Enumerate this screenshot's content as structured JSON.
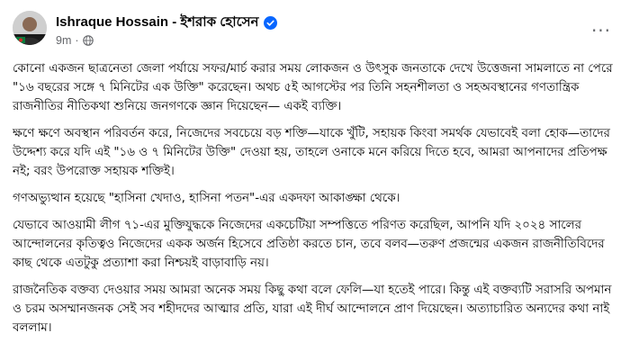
{
  "post": {
    "author": "Ishraque Hossain - ইশরাক হোসেন",
    "time": "9m",
    "dot": "·",
    "more_label": "···",
    "paragraphs": [
      "কোনো একজন ছাত্রনেতা জেলা পর্যায়ে সফর/মার্চ করার সময় লোকজন ও উৎসুক জনতাকে দেখে উত্তেজনা সামলাতে না পেরে \"১৬ বছরের সঙ্গে ৭ মিনিটের এক উক্তি\" করেছেন। অথচ ৫ই আগস্টের পর তিনি সহনশীলতা ও সহঅবস্থানের গণতান্ত্রিক রাজনীতির নীতিকথা শুনিয়ে জনগণকে জ্ঞান দিয়েছেন— একই ব্যক্তি।",
      "ক্ষণে ক্ষণে অবস্থান পরিবর্তন করে, নিজেদের সবচেয়ে বড় শক্তি—যাকে খুঁটি, সহায়ক কিংবা সমর্থক যেভাবেই বলা হোক—তাদের উদ্দেশ্য করে যদি এই \"১৬ ও ৭ মিনিটের উক্তি\" দেওয়া হয়, তাহলে ওনাকে মনে করিয়ে দিতে হবে, আমরা আপনাদের প্রতিপক্ষ নই; বরং উপরোক্ত সহায়ক শক্তিই।",
      "গণঅভ্যুত্থান হয়েছে \"হাসিনা খেদাও, হাসিনা পতন\"-এর একদফা আকাঙ্ক্ষা থেকে।",
      "যেভাবে আওয়ামী লীগ ৭১-এর মুক্তিযুদ্ধকে নিজেদের একচেটিয়া সম্পত্তিতে পরিণত করেছিল, আপনি যদি ২০২৪ সালের আন্দোলনের কৃতিত্বও নিজেদের একক অর্জন হিসেবে প্রতিষ্ঠা করতে চান, তবে বলব—তরুণ প্রজন্মের একজন রাজনীতিবিদের কাছ থেকে এতটুকু প্রত্যাশা করা নিশ্চয়ই বাড়াবাড়ি নয়।",
      "রাজনৈতিক বক্তব্য দেওয়ার সময় আমরা অনেক সময় কিছু কথা বলে ফেলি—যা হতেই পারে। কিন্তু এই বক্তব্যটি সরাসরি অপমান ও চরম অসম্মানজনক সেই সব শহীদদের আত্মার প্রতি, যারা এই দীর্ঘ আন্দোলনে প্রাণ দিয়েছেন। অত্যাচারিত অন্যদের কথা নাই বললাম।"
    ]
  },
  "colors": {
    "verified": "#0866ff",
    "meta": "#65676b",
    "text": "#050505"
  },
  "icons": {
    "avatar": "avatar",
    "verified": "verified-badge-icon",
    "globe": "globe-icon",
    "more": "more-options-icon"
  }
}
